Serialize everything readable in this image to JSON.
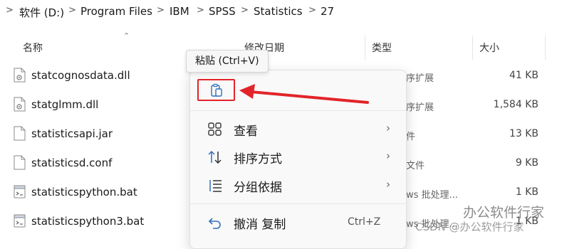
{
  "breadcrumb": [
    "软件 (D:)",
    "Program Files",
    "IBM",
    "SPSS",
    "Statistics",
    "27"
  ],
  "columns": {
    "name": "名称",
    "modified": "修改日期",
    "type": "类型",
    "size": "大小"
  },
  "files": [
    {
      "name": "statcognosdata.dll",
      "type": "序扩展",
      "size": "41 KB",
      "icon": "dll-file-icon"
    },
    {
      "name": "statglmm.dll",
      "type": "序扩展",
      "size": "1,584 KB",
      "icon": "dll-file-icon"
    },
    {
      "name": "statisticsapi.jar",
      "type": "件",
      "size": "13 KB",
      "icon": "file-icon"
    },
    {
      "name": "statisticsd.conf",
      "type": "文件",
      "size": "9 KB",
      "icon": "file-icon"
    },
    {
      "name": "statisticspython.bat",
      "type": "ws 批处理...",
      "size": "1 KB",
      "icon": "bat-file-icon"
    },
    {
      "name": "statisticspython3.bat",
      "type": "ws 批处理...",
      "size": "1 KB",
      "icon": "bat-file-icon"
    }
  ],
  "tooltip": "粘贴 (Ctrl+V)",
  "menu": {
    "paste_icon": "clipboard-icon",
    "items": [
      {
        "label": "查看",
        "icon": "grid-view-icon",
        "submenu": true
      },
      {
        "label": "排序方式",
        "icon": "sort-icon",
        "submenu": true
      },
      {
        "label": "分组依据",
        "icon": "group-list-icon",
        "submenu": true
      },
      {
        "label": "撤消 复制",
        "icon": "undo-icon",
        "shortcut": "Ctrl+Z"
      }
    ]
  },
  "annotation": {
    "arrow_color": "#e2242a",
    "highlight_color": "#e2242a"
  },
  "watermark": {
    "line1": "办公软件行家",
    "line2": "CSDN @办公软件行家"
  }
}
